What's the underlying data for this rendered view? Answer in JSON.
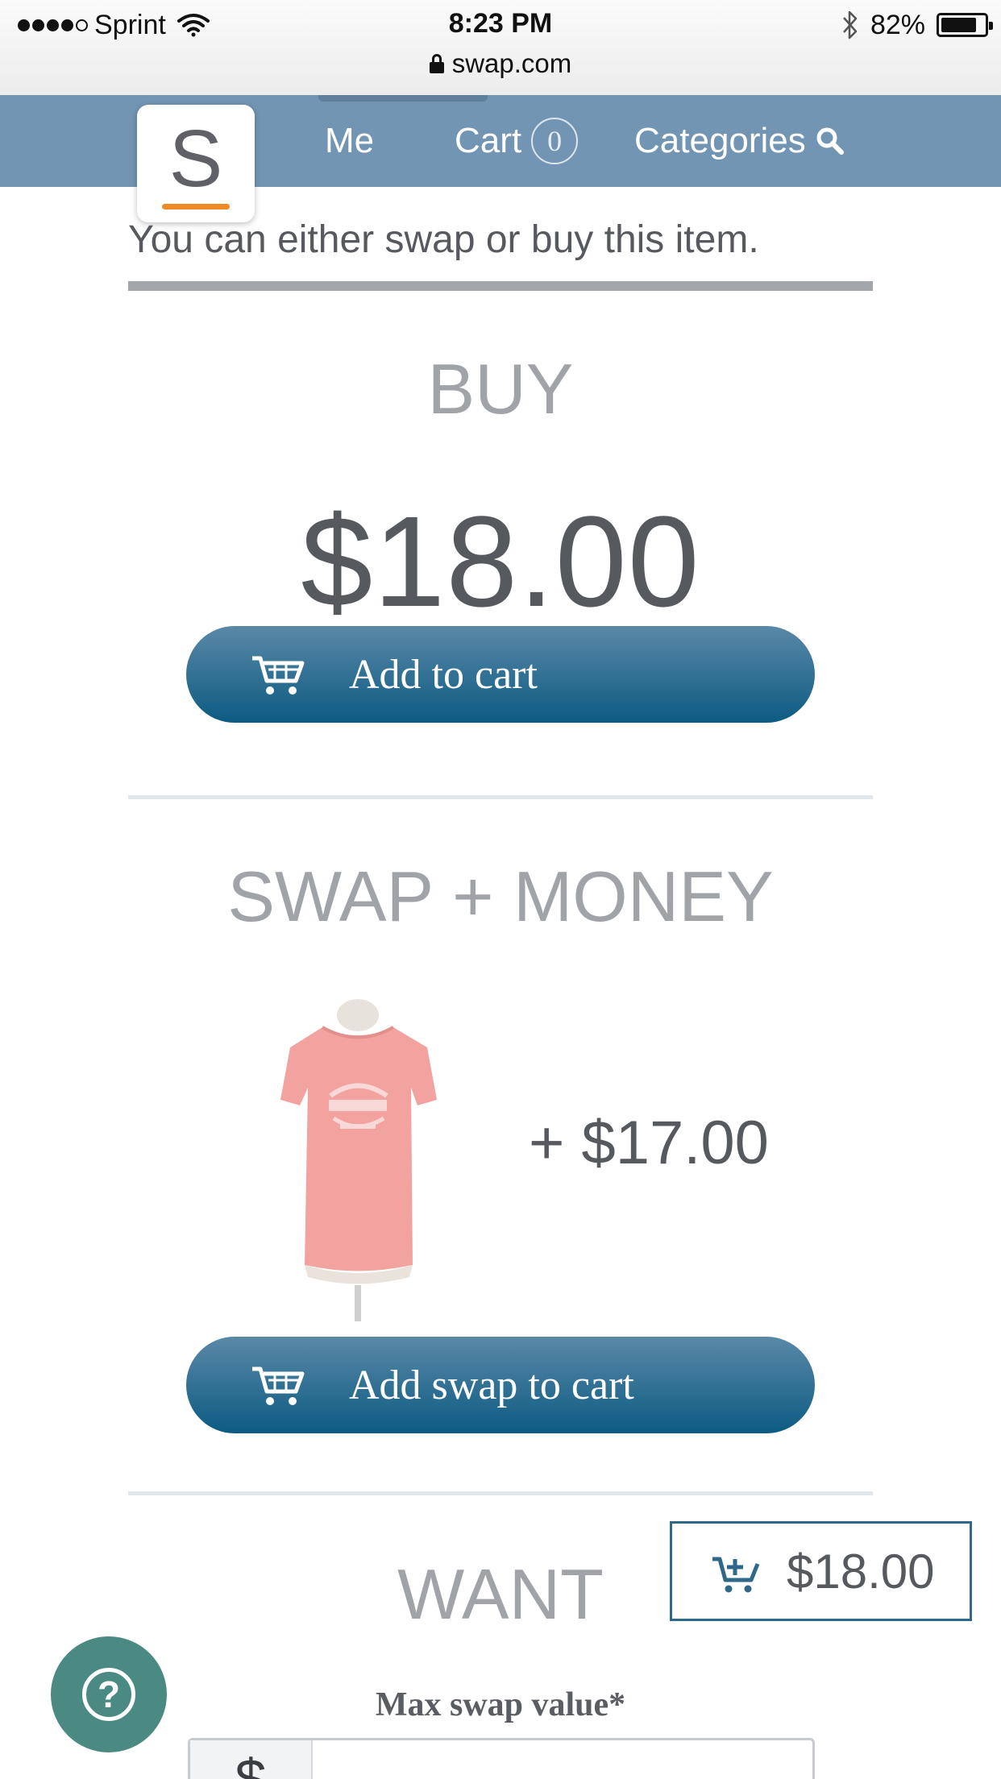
{
  "status_bar": {
    "carrier": "Sprint",
    "time": "8:23 PM",
    "battery_percent": "82%",
    "battery_level": 0.82,
    "url": "swap.com"
  },
  "nav": {
    "logo_letter": "S",
    "me_label": "Me",
    "cart_label": "Cart",
    "cart_count": "0",
    "categories_label": "Categories"
  },
  "intro_text": "You can either swap or buy this item.",
  "buy": {
    "title": "BUY",
    "price": "$18.00",
    "button_label": "Add to cart"
  },
  "swap_money": {
    "title": "SWAP + MONEY",
    "extra_price": "+ $17.00",
    "button_label": "Add swap to cart"
  },
  "want": {
    "title": "WANT",
    "max_swap_label": "Max swap value*",
    "currency_prefix": "$"
  },
  "floating_cart": {
    "price": "$18.00"
  },
  "help": {
    "icon_glyph": "?"
  },
  "colors": {
    "nav_bg": "#7295b3",
    "button_gradient_top": "#5a88a7",
    "button_gradient_bottom": "#0c5b82",
    "logo_accent": "#f08a24",
    "help_bg": "#4b8a82"
  },
  "icons": [
    "wifi-icon",
    "bluetooth-icon",
    "battery-icon",
    "lock-icon",
    "search-icon",
    "cart-icon",
    "cart-plus-icon",
    "help-icon"
  ]
}
